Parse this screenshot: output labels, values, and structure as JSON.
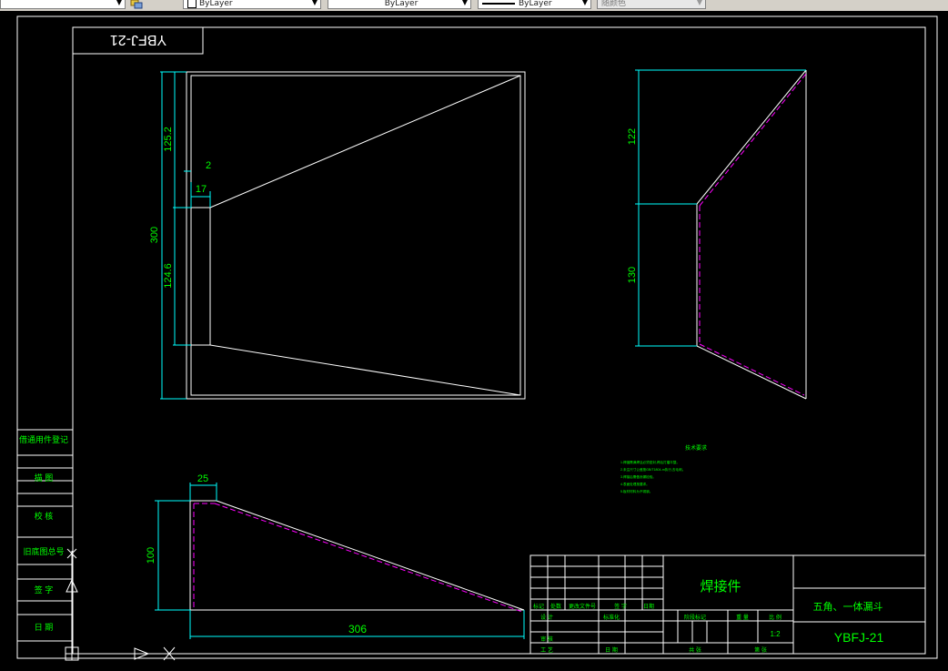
{
  "toolbar": {
    "layer_color_label": "ByLayer",
    "linetype_label": "ByLayer",
    "lineweight_label": "ByLayer",
    "plotstyle_label": "随颜色"
  },
  "drawing": {
    "title_block_mirrored": "YBFJ-21",
    "dimensions": {
      "front_total_height": "300",
      "front_top_height": "125.2",
      "front_mid_height": "124.6",
      "front_wall": "2",
      "front_inner_width": "17",
      "side_top_height": "122",
      "side_bottom_height": "130",
      "bottom_height": "100",
      "bottom_top_width": "25",
      "bottom_total_width": "306"
    },
    "notes_title": "技术要求",
    "notes_lines": [
      "1.焊缝需满焊且必须密封,焊后打磨平整。",
      "2.未注尺寸公差按GB/T1804-m执行,去毛刺。",
      "3.焊接后需做渗漏检验。",
      "4.表面处理按要求。",
      "5.板材材料为不锈钢。"
    ],
    "left_strip_labels": [
      "借通用件登记",
      "描 图",
      "校 核",
      "旧底图总号",
      "签 字",
      "日 期"
    ],
    "title_block": {
      "part_name": "焊接件",
      "product_name": "五角、一体漏斗",
      "drawing_number": "YBFJ-21",
      "scale": "1:2",
      "row_labels": [
        "标记",
        "处数",
        "更改文件号",
        "签 字",
        "日期"
      ],
      "lower_labels": [
        "设 计",
        "标准化",
        "审 核",
        "工 艺",
        "日 期"
      ],
      "stage_label": "阶段标记",
      "weight_label": "重 量",
      "scale_label": "比 例",
      "sheet_label": "共 张",
      "sheet_of_label": "第 张"
    }
  },
  "colors": {
    "background": "#000000",
    "border": "#ffffff",
    "dimension": "#00ffff",
    "dim_text": "#00ff00",
    "hidden": "#ff00ff"
  }
}
